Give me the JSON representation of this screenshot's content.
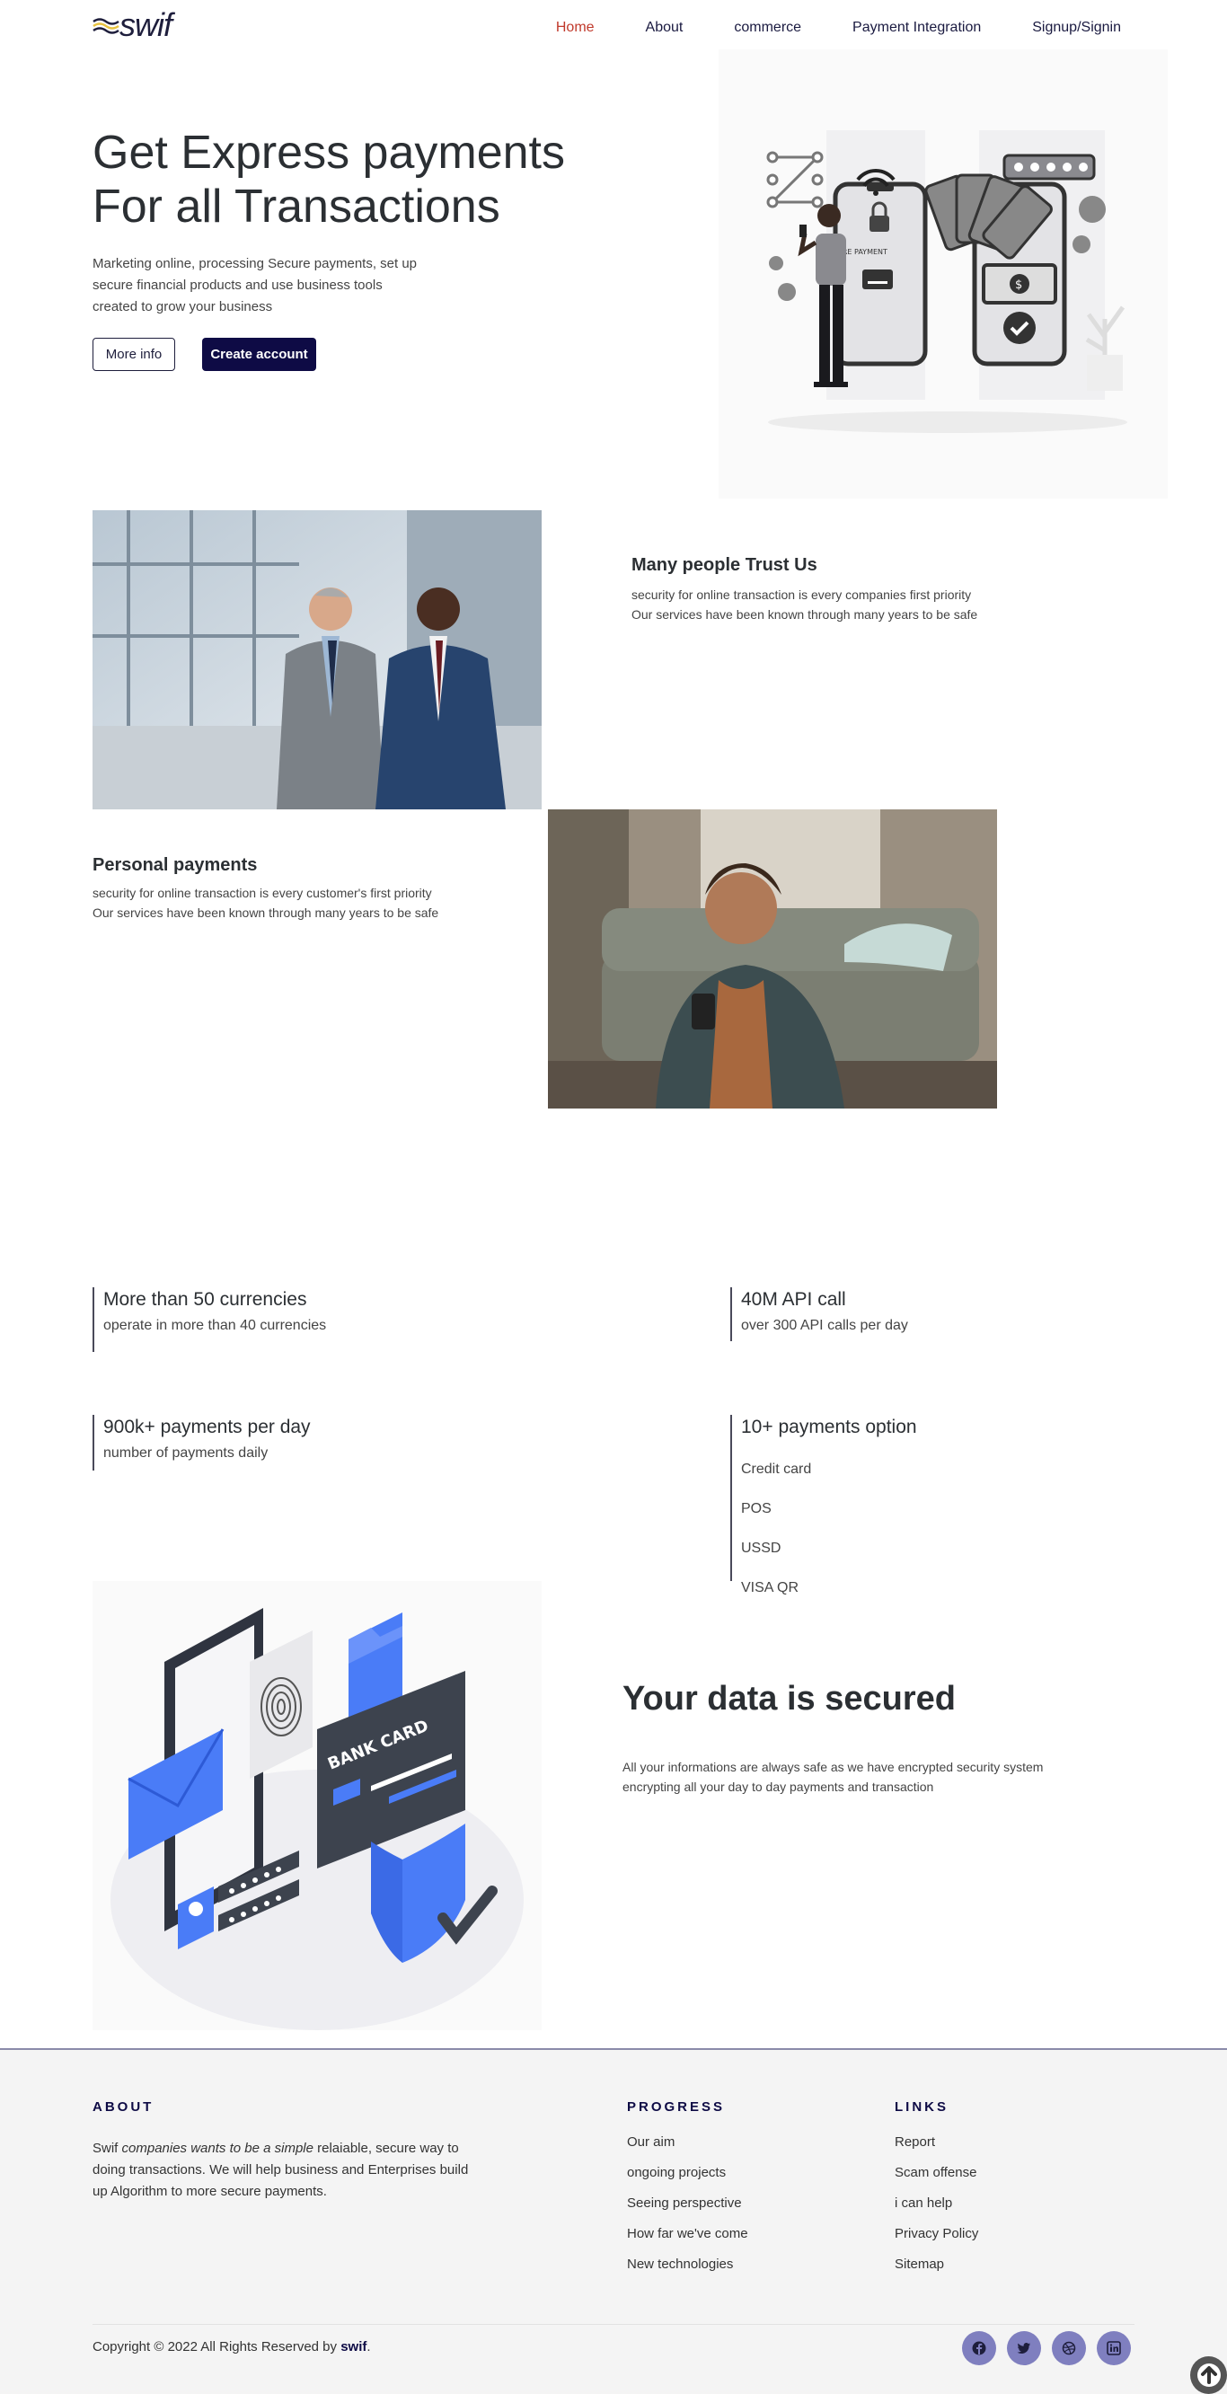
{
  "nav": {
    "logo": "swif",
    "links": [
      "Home",
      "About",
      "commerce",
      "Payment Integration",
      "Signup/Signin"
    ]
  },
  "hero": {
    "title_line1": "Get Express payments",
    "title_line2": "For all Transactions",
    "description": "Marketing online, processing Secure payments, set up secure financial products and use business tools created to grow your business",
    "more_info": "More info",
    "create_account": "Create account",
    "illustration_label": "URE PAYMENT"
  },
  "trust": {
    "title": "Many people Trust Us",
    "line1": "security for online transaction is every companies first priority",
    "line2": "Our services have been known through many years to be safe"
  },
  "personal": {
    "title": "Personal payments",
    "line1": "security for online transaction is every customer's first priority",
    "line2": "Our services have been known through many years to be safe"
  },
  "stats": [
    {
      "title": "More than 50 currencies",
      "sub": "operate in more than 40 currencies"
    },
    {
      "title": "40M API call",
      "sub": "over 300 API calls per day"
    },
    {
      "title": "900k+ payments per day",
      "sub": "number of payments daily"
    },
    {
      "title": "10+ payments option",
      "options": [
        "Credit card",
        "POS",
        "USSD",
        "VISA QR"
      ]
    }
  ],
  "secure": {
    "title": "Your data is secured",
    "text": "All your informations are always safe as we have encrypted security system encrypting all your day to day payments and transaction",
    "card_label": "BANK CARD"
  },
  "footer": {
    "about_head": "ABOUT",
    "about_pre": "Swif ",
    "about_italic": "companies wants to be a simple",
    "about_post": " relaiable, secure way to doing transactions. We will help business and Enterprises build up Algorithm to more secure payments.",
    "progress_head": "PROGRESS",
    "progress": [
      "Our aim",
      "ongoing projects",
      "Seeing perspective",
      "How far we've come",
      "New technologies"
    ],
    "links_head": "LINKS",
    "links": [
      "Report",
      "Scam offense",
      "i can help",
      "Privacy Policy",
      "Sitemap"
    ],
    "copyright_pre": "Copyright © 2022 All Rights Reserved by ",
    "copyright_brand": "swif",
    "copyright_post": ".",
    "socials": [
      "facebook-icon",
      "twitter-icon",
      "dribbble-icon",
      "linkedin-icon"
    ]
  },
  "colors": {
    "accent": "#0e0b45",
    "active": "#c0392b",
    "social": "#7f7fbf",
    "blue": "#4a7cf7"
  }
}
